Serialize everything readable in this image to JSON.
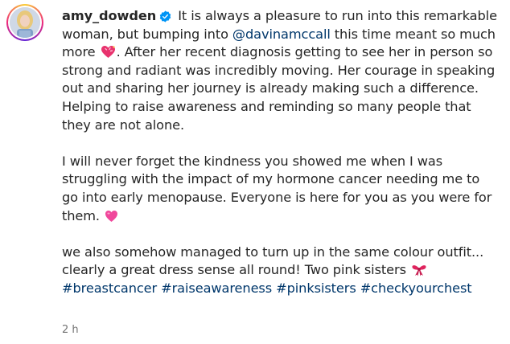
{
  "post": {
    "username": "amy_dowden",
    "verified": true,
    "caption_lines": [
      " It is always a pleasure to run into this remarkable",
      "woman, but bumping into ",
      "@davinamccall",
      " this time meant so much",
      "more ",
      ". After her recent diagnosis getting to see her in person so",
      "strong and radiant was incredibly moving. Her courage in speaking",
      "out and sharing her journey is already making such a difference.",
      "Helping to raise awareness and reminding so many people that",
      "they are not alone.",
      "I will never forget the kindness you showed me when I was",
      "struggling with the impact of my hormone cancer needing me to",
      "go into early menopause. Everyone is here for you as you were for",
      "them. ",
      "we also somehow managed to turn up in the same colour outfit...",
      "clearly a great dress sense all round! Two pink sisters "
    ],
    "hashtags": [
      "#breastcancer",
      "#raiseawareness",
      "#pinksisters",
      "#checkyourchest"
    ],
    "timestamp": "2 h",
    "icons": {
      "verified": "verified-badge-icon",
      "heart_sparkle": "heart-with-sparkle-emoji",
      "pink_heart": "pink-heart-emoji",
      "ribbon": "pink-ribbon-bow-emoji"
    },
    "colors": {
      "text": "#262626",
      "link": "#00376b",
      "verified": "#0095f6",
      "timestamp": "#737373"
    }
  }
}
